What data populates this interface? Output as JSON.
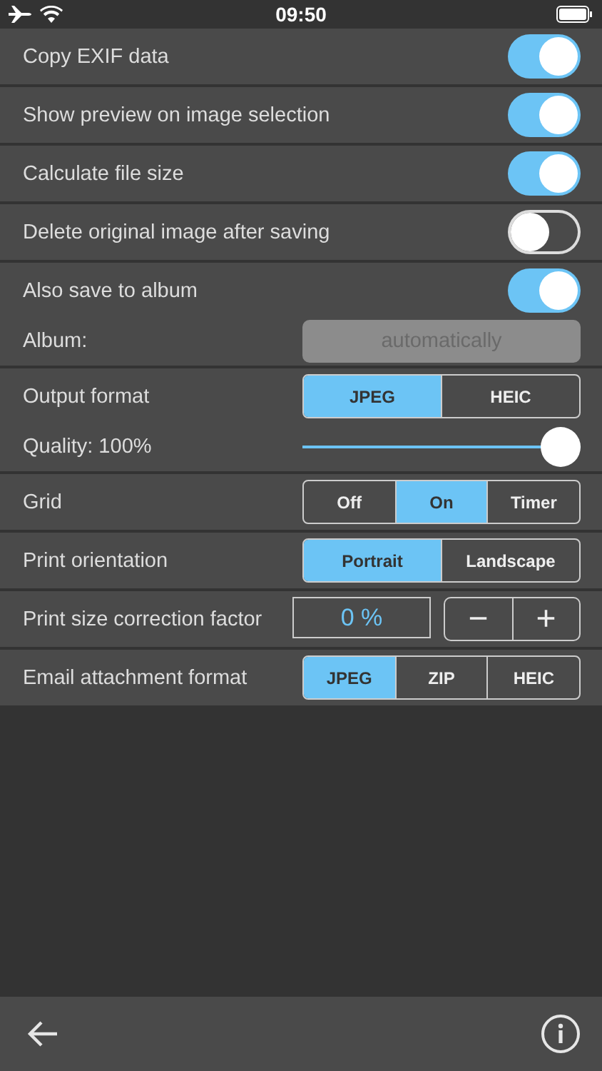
{
  "status_bar": {
    "time": "09:50"
  },
  "groups": [
    {
      "lines": [
        {
          "kind": "toggle",
          "label": "Copy EXIF data",
          "on": true
        }
      ]
    },
    {
      "lines": [
        {
          "kind": "toggle",
          "label": "Show preview on image selection",
          "on": true
        }
      ]
    },
    {
      "lines": [
        {
          "kind": "toggle",
          "label": "Calculate file size",
          "on": true
        }
      ]
    },
    {
      "lines": [
        {
          "kind": "toggle",
          "label": "Delete original image after saving",
          "on": false
        }
      ]
    },
    {
      "lines": [
        {
          "kind": "toggle",
          "label": "Also save to album",
          "on": true
        },
        {
          "kind": "field",
          "label": "Album:",
          "value": "automatically",
          "disabled": true
        }
      ]
    },
    {
      "lines": [
        {
          "kind": "segmented",
          "label": "Output format",
          "options": [
            {
              "label": "JPEG",
              "selected": true
            },
            {
              "label": "HEIC",
              "selected": false
            }
          ]
        },
        {
          "kind": "slider",
          "label": "Quality: 100%",
          "level": 1.0
        }
      ]
    },
    {
      "lines": [
        {
          "kind": "segmented",
          "label": "Grid",
          "options": [
            {
              "label": "Off",
              "selected": false
            },
            {
              "label": "On",
              "selected": true
            },
            {
              "label": "Timer",
              "selected": false
            }
          ]
        }
      ]
    },
    {
      "lines": [
        {
          "kind": "segmented",
          "label": "Print orientation",
          "options": [
            {
              "label": "Portrait",
              "selected": true
            },
            {
              "label": "Landscape",
              "selected": false
            }
          ]
        }
      ]
    },
    {
      "lines": [
        {
          "kind": "stepper",
          "label": "Print size correction factor",
          "value": "0 %",
          "minus": "−",
          "plus": "+"
        }
      ]
    },
    {
      "lines": [
        {
          "kind": "segmented",
          "label": "Email attachment format",
          "options": [
            {
              "label": "JPEG",
              "selected": true
            },
            {
              "label": "ZIP",
              "selected": false
            },
            {
              "label": "HEIC",
              "selected": false
            }
          ]
        }
      ]
    }
  ]
}
